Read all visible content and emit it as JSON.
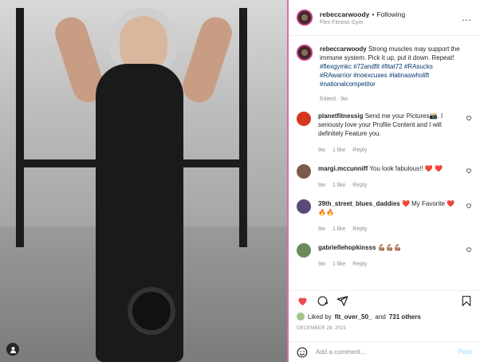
{
  "header": {
    "username": "rebeccarwoody",
    "separator": "•",
    "follow_status": "Following",
    "location": "Flex Fitness Gym",
    "more_label": "..."
  },
  "caption": {
    "username": "rebeccarwoody",
    "text": "Strong muscles may support the immune system. Pick it up, put it down. Repeat!",
    "hashtags": "#flexgymkc #72andfit #fitat72 #RAsucks #RAwarrior #noexcuses #latinaswholift #nationalcompetitor",
    "meta": "Edited · 9w"
  },
  "comments": [
    {
      "username": "planetfitnessig",
      "text": "Send me your Pictures📸. I seriously love your Profile Content and I will definitely Feature you.",
      "age": "9w",
      "likes": "1 like",
      "reply": "Reply",
      "avatar_color": "#d6381f"
    },
    {
      "username": "margi.mccunniff",
      "text": "You look fabulous!! ❤️ ❤️",
      "age": "9w",
      "likes": "1 like",
      "reply": "Reply",
      "avatar_color": "#7b5c4c"
    },
    {
      "username": "39th_street_blues_daddies",
      "text": "❤️ My Favorite ❤️ 🔥🔥",
      "age": "9w",
      "likes": "1 like",
      "reply": "Reply",
      "avatar_color": "#5a4a7a"
    },
    {
      "username": "gabriellehopkinsss",
      "text": "💪🏽💪🏽💪🏽",
      "age": "9w",
      "likes": "1 like",
      "reply": "Reply",
      "avatar_color": "#6b8a5a"
    }
  ],
  "likes": {
    "prefix": "Liked by",
    "user": "fit_over_50_",
    "middle": "and",
    "count": "731 others"
  },
  "date": "DECEMBER 29, 2021",
  "add_comment": {
    "placeholder": "Add a comment...",
    "post_label": "Post"
  },
  "colors": {
    "liked_heart": "#ed4956",
    "link": "#00376b",
    "post_disabled": "#b2dffc",
    "panel_accent": "#e26ab2"
  },
  "icons": [
    "more-icon",
    "heart-icon",
    "comment-icon",
    "share-icon",
    "bookmark-icon",
    "emoji-icon",
    "user-tag-icon"
  ]
}
